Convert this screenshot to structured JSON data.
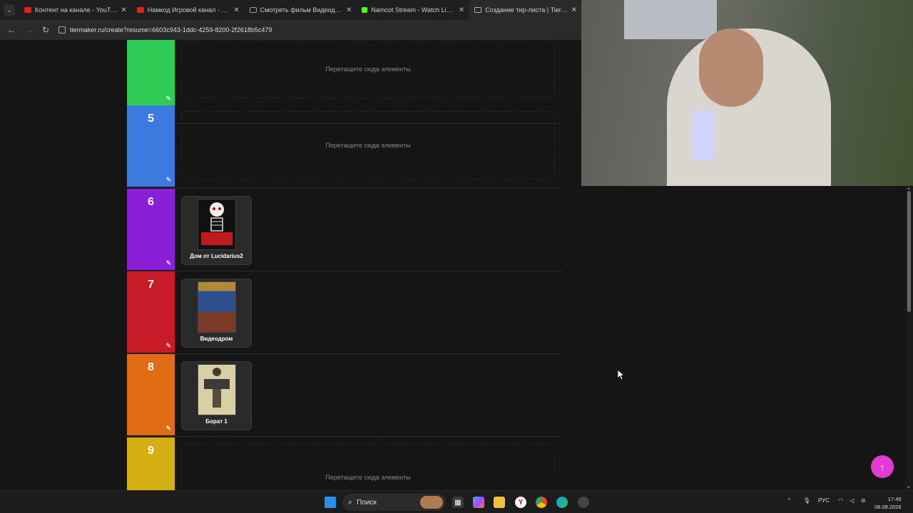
{
  "browser": {
    "tabs": [
      {
        "title": "Контент на канале - YouTube S",
        "favicon": "youtube-icon",
        "active": false
      },
      {
        "title": "Намкод Игровой канал - YouT",
        "favicon": "youtube-icon",
        "active": false
      },
      {
        "title": "Смотреть фильм Видеодром с",
        "favicon": "film-icon",
        "active": false
      },
      {
        "title": "Namcot Stream - Watch Live or",
        "favicon": "kick-icon",
        "active": false
      },
      {
        "title": "Создание тир-листа | TierMak",
        "favicon": "tiermaker-icon",
        "active": true
      }
    ],
    "url": "tiermaker.ru/create?resume=6603c943-1ddc-4259-8200-2f2618b5c479"
  },
  "tiers": [
    {
      "label": "",
      "color": "#2fcc55",
      "placeholder": "Перетащите сюда элементы"
    },
    {
      "label": "5",
      "color": "#3d7ae0",
      "placeholder": "Перетащите сюда элементы"
    },
    {
      "label": "6",
      "color": "#8a1fd8",
      "item": {
        "title": "Дом от Lucidarius2"
      }
    },
    {
      "label": "7",
      "color": "#c81b2a",
      "item": {
        "title": "Видеодром"
      }
    },
    {
      "label": "8",
      "color": "#e06d14",
      "item": {
        "title": "Борат 1"
      }
    },
    {
      "label": "9",
      "color": "#d4b012",
      "placeholder": "Перетащите сюда элементы"
    }
  ],
  "taskbar": {
    "search_placeholder": "Поиск",
    "language": "РУС",
    "time": "17:49",
    "date": "08.08.2026"
  },
  "scroll_top_icon": "arrow-up-icon"
}
